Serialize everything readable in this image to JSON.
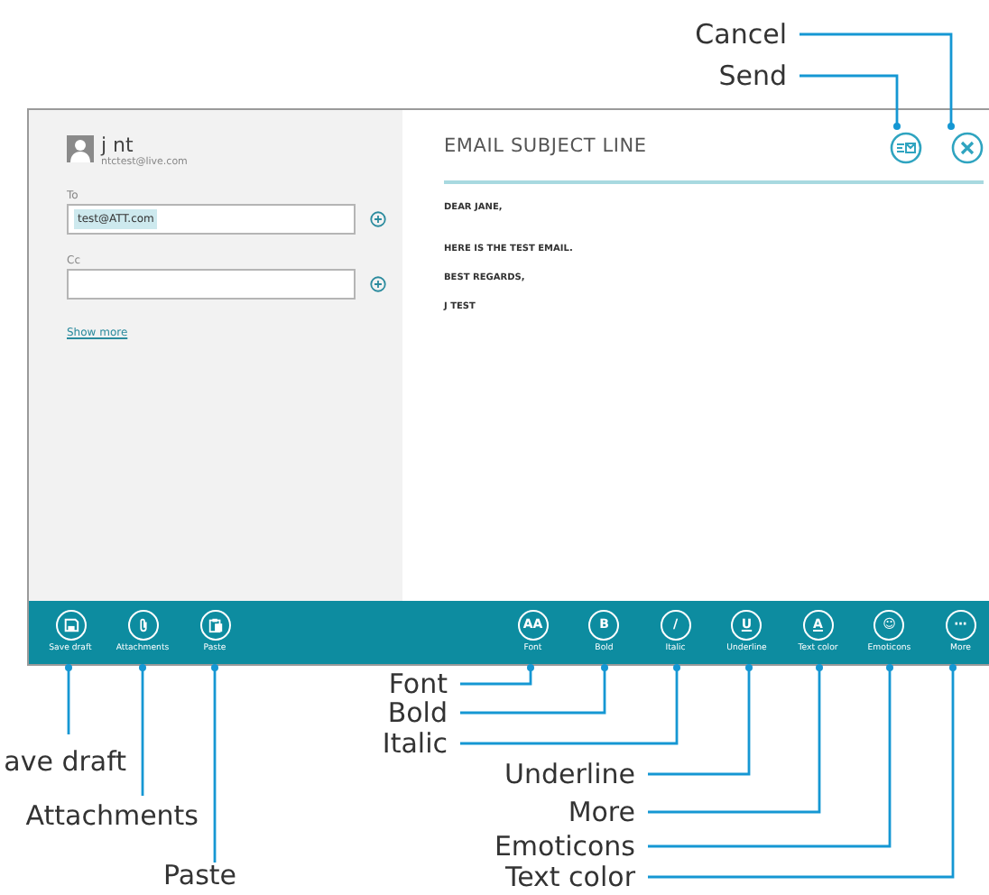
{
  "account": {
    "name": "j nt",
    "email": "ntctest@live.com"
  },
  "to": {
    "label": "To",
    "recipients": [
      "test@ATT.com"
    ]
  },
  "cc": {
    "label": "Cc"
  },
  "show_more": "Show more",
  "subject": "EMAIL SUBJECT LINE",
  "body": [
    "DEAR JANE,",
    "HERE IS THE TEST EMAIL.",
    "BEST REGARDS,",
    "J TEST"
  ],
  "app_bar": {
    "left": [
      {
        "kind": "save",
        "label": "Save draft"
      },
      {
        "kind": "attach",
        "label": "Attachments"
      },
      {
        "kind": "paste",
        "label": "Paste"
      }
    ],
    "right": [
      {
        "kind": "glyph",
        "glyph": "AA",
        "label": "Font"
      },
      {
        "kind": "glyph",
        "glyph": "B",
        "label": "Bold"
      },
      {
        "kind": "glyph",
        "glyph": "/",
        "label": "Italic"
      },
      {
        "kind": "underlined",
        "glyph": "U",
        "label": "Underline"
      },
      {
        "kind": "underlined",
        "glyph": "A",
        "label": "Text color"
      },
      {
        "kind": "glyph",
        "glyph": "☺",
        "label": "Emoticons"
      },
      {
        "kind": "glyph",
        "glyph": "⋯",
        "label": "More"
      }
    ]
  },
  "callouts": {
    "top": [
      "Cancel",
      "Send"
    ],
    "left": [
      "ave draft",
      "Attachments",
      "Paste"
    ],
    "right": [
      "Font",
      "Bold",
      "Italic",
      "Underline",
      "More",
      "Emoticons",
      "Text color"
    ]
  }
}
